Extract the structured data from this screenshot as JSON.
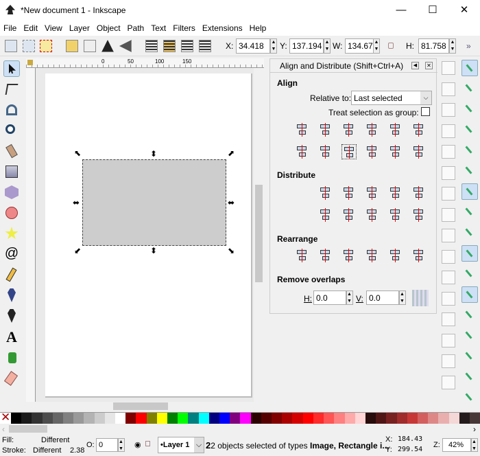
{
  "window": {
    "title": "*New document 1 - Inkscape",
    "minimize": "—",
    "maximize": "☐",
    "close": "✕"
  },
  "menu": [
    "File",
    "Edit",
    "View",
    "Layer",
    "Object",
    "Path",
    "Text",
    "Filters",
    "Extensions",
    "Help"
  ],
  "toolbar": {
    "x_label": "X:",
    "x": "34.418",
    "y_label": "Y:",
    "y": "137.194",
    "w_label": "W:",
    "w": "134.675",
    "h_label": "H:",
    "h": "81.758",
    "more": "»"
  },
  "ruler": {
    "ticks": [
      "0",
      "50",
      "100",
      "150"
    ]
  },
  "dock": {
    "title": "Align and Distribute (Shift+Ctrl+A)",
    "align_heading": "Align",
    "relative_label": "Relative to:",
    "relative_value": "Last selected",
    "group_label": "Treat selection as group:",
    "group_checked": false,
    "distribute_heading": "Distribute",
    "rearrange_heading": "Rearrange",
    "overlaps_heading": "Remove overlaps",
    "h_label": "H:",
    "h_value": "0.0",
    "v_label": "V:",
    "v_value": "0.0"
  },
  "palette": [
    "#000000",
    "#1a1a1a",
    "#333333",
    "#4d4d4d",
    "#666666",
    "#808080",
    "#999999",
    "#b3b3b3",
    "#cccccc",
    "#e6e6e6",
    "#ffffff",
    "#800000",
    "#ff0000",
    "#808000",
    "#ffff00",
    "#008000",
    "#00ff00",
    "#008080",
    "#00ffff",
    "#000080",
    "#0000ff",
    "#800080",
    "#ff00ff",
    "#2b0000",
    "#550000",
    "#800000",
    "#aa0000",
    "#d40000",
    "#ff0000",
    "#ff2a2a",
    "#ff5555",
    "#ff8080",
    "#ffaaaa",
    "#ffd5d5",
    "#280b0b",
    "#501616",
    "#782121",
    "#a02c2c",
    "#c83737",
    "#d35f5f",
    "#de8787",
    "#e9afaf",
    "#f4d7d7",
    "#241c1c",
    "#483737"
  ],
  "status": {
    "fill_label": "Fill:",
    "fill_value": "Different",
    "stroke_label": "Stroke:",
    "stroke_value": "Different",
    "stroke_width": "2.38",
    "opacity_label": "O:",
    "opacity": "0",
    "layer": "•Layer 1",
    "message_pre": "2 objects selected of types ",
    "message_bold": "Image, Rectangle i...",
    "cx_label": "X:",
    "cx": "184.43",
    "cy_label": "Y:",
    "cy": "299.54",
    "zoom_label": "Z:",
    "zoom": "42%"
  }
}
